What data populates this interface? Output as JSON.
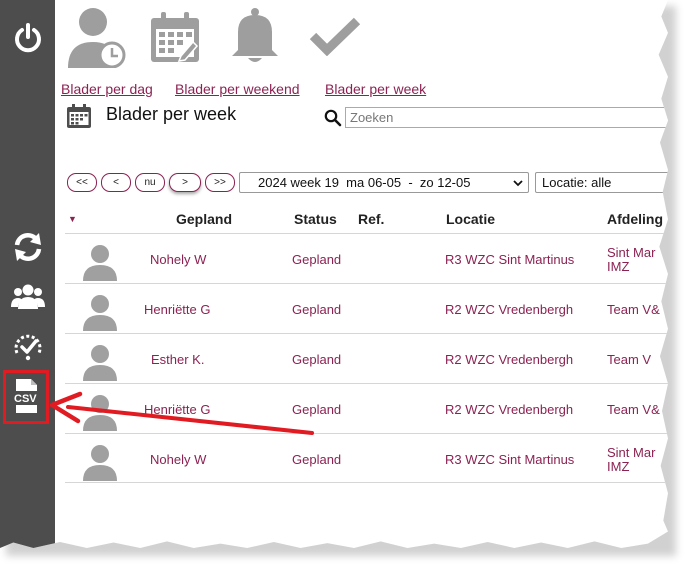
{
  "nav_links": [
    {
      "label": "Blader per dag"
    },
    {
      "label": "Blader per weekend"
    },
    {
      "label": "Blader per week"
    }
  ],
  "page_title": "Blader per week",
  "search": {
    "placeholder": "Zoeken",
    "value": ""
  },
  "pager": {
    "first": "<<",
    "prev": "<",
    "now": "nu",
    "next": ">",
    "last": ">>"
  },
  "week_select": {
    "value": "2024 week 19  ma 06-05  -  zo 12-05"
  },
  "location_select": {
    "value": "Locatie: alle"
  },
  "table": {
    "headers": [
      "Gepland",
      "Status",
      "Ref.",
      "Locatie",
      "Afdeling"
    ],
    "rows": [
      {
        "name": "Nohely W",
        "status": "Gepland",
        "ref": "",
        "locatie": "R3 WZC Sint Martinus",
        "afdeling": [
          "Sint Mar",
          "IMZ"
        ]
      },
      {
        "name": "Henriëtte G",
        "status": "Gepland",
        "ref": "",
        "locatie": "R2 WZC Vredenbergh",
        "afdeling": [
          "Team V&",
          ""
        ]
      },
      {
        "name": "Esther K.",
        "status": "Gepland",
        "ref": "",
        "locatie": "R2 WZC Vredenbergh",
        "afdeling": [
          "Team V",
          ""
        ]
      },
      {
        "name": "Henriëtte G",
        "status": "Gepland",
        "ref": "",
        "locatie": "R2 WZC Vredenbergh",
        "afdeling": [
          "Team V&",
          ""
        ]
      },
      {
        "name": "Nohely W",
        "status": "Gepland",
        "ref": "",
        "locatie": "R3 WZC Sint Martinus",
        "afdeling": [
          "Sint Mar",
          "IMZ"
        ]
      }
    ]
  },
  "sidebar": {
    "icons": [
      "power-icon",
      "refresh-icon",
      "users-icon",
      "dashboard-check-icon",
      "csv-file-icon"
    ],
    "csv_label": "CSV"
  },
  "toolbar_icons": [
    "user-clock-icon",
    "calendar-icon",
    "bell-icon",
    "checkmark-icon"
  ],
  "colors": {
    "sidebar": "#4d4d4d",
    "accent": "#8b2252",
    "highlight": "#e11b22",
    "icon_gray": "#9e9e9e"
  }
}
